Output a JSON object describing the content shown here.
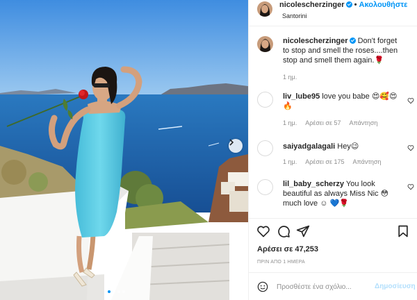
{
  "header": {
    "username": "nicolescherzinger",
    "separator": "•",
    "follow_label": "Ακολουθήστε",
    "location": "Santorini",
    "avatar_icon": "profile-avatar"
  },
  "caption": {
    "username": "nicolescherzinger",
    "text": "Don't forget to stop and smell the roses....then stop and smell them again.",
    "emoji": "🌹",
    "age": "1 ημ."
  },
  "comments": [
    {
      "username": "liv_lube95",
      "text": "love you babe",
      "emoji": "😍🥰😍🔥",
      "age": "1 ημ.",
      "likes": "Αρέσει σε 57",
      "reply_label": "Απάντηση"
    },
    {
      "username": "saiyadgalagali",
      "text": "Hey",
      "emoji": "😉",
      "age": "1 ημ.",
      "likes": "Αρέσει σε 175",
      "reply_label": "Απάντηση"
    },
    {
      "username": "lil_baby_scherzy",
      "text": "You look beautiful as always Miss Nic",
      "emoji1": "😳",
      "text2": "much love ☺",
      "emoji2": "💙🌹"
    }
  ],
  "likes_text": "Αρέσει σε 47,253",
  "time_ago": "ΠΡΙΝ ΑΠΟ 1 ΗΜΕΡΑ",
  "composer": {
    "placeholder": "Προσθέστε ένα σχόλιο...",
    "post_label": "Δημοσίευση"
  },
  "colors": {
    "accent": "#0095f6",
    "post_disabled": "#b2dffc",
    "dress": "#5fd0e6",
    "sea": "#1f6fb4",
    "sky": "#5aa6e8"
  },
  "carousel": {
    "current": 1,
    "total": 4
  }
}
